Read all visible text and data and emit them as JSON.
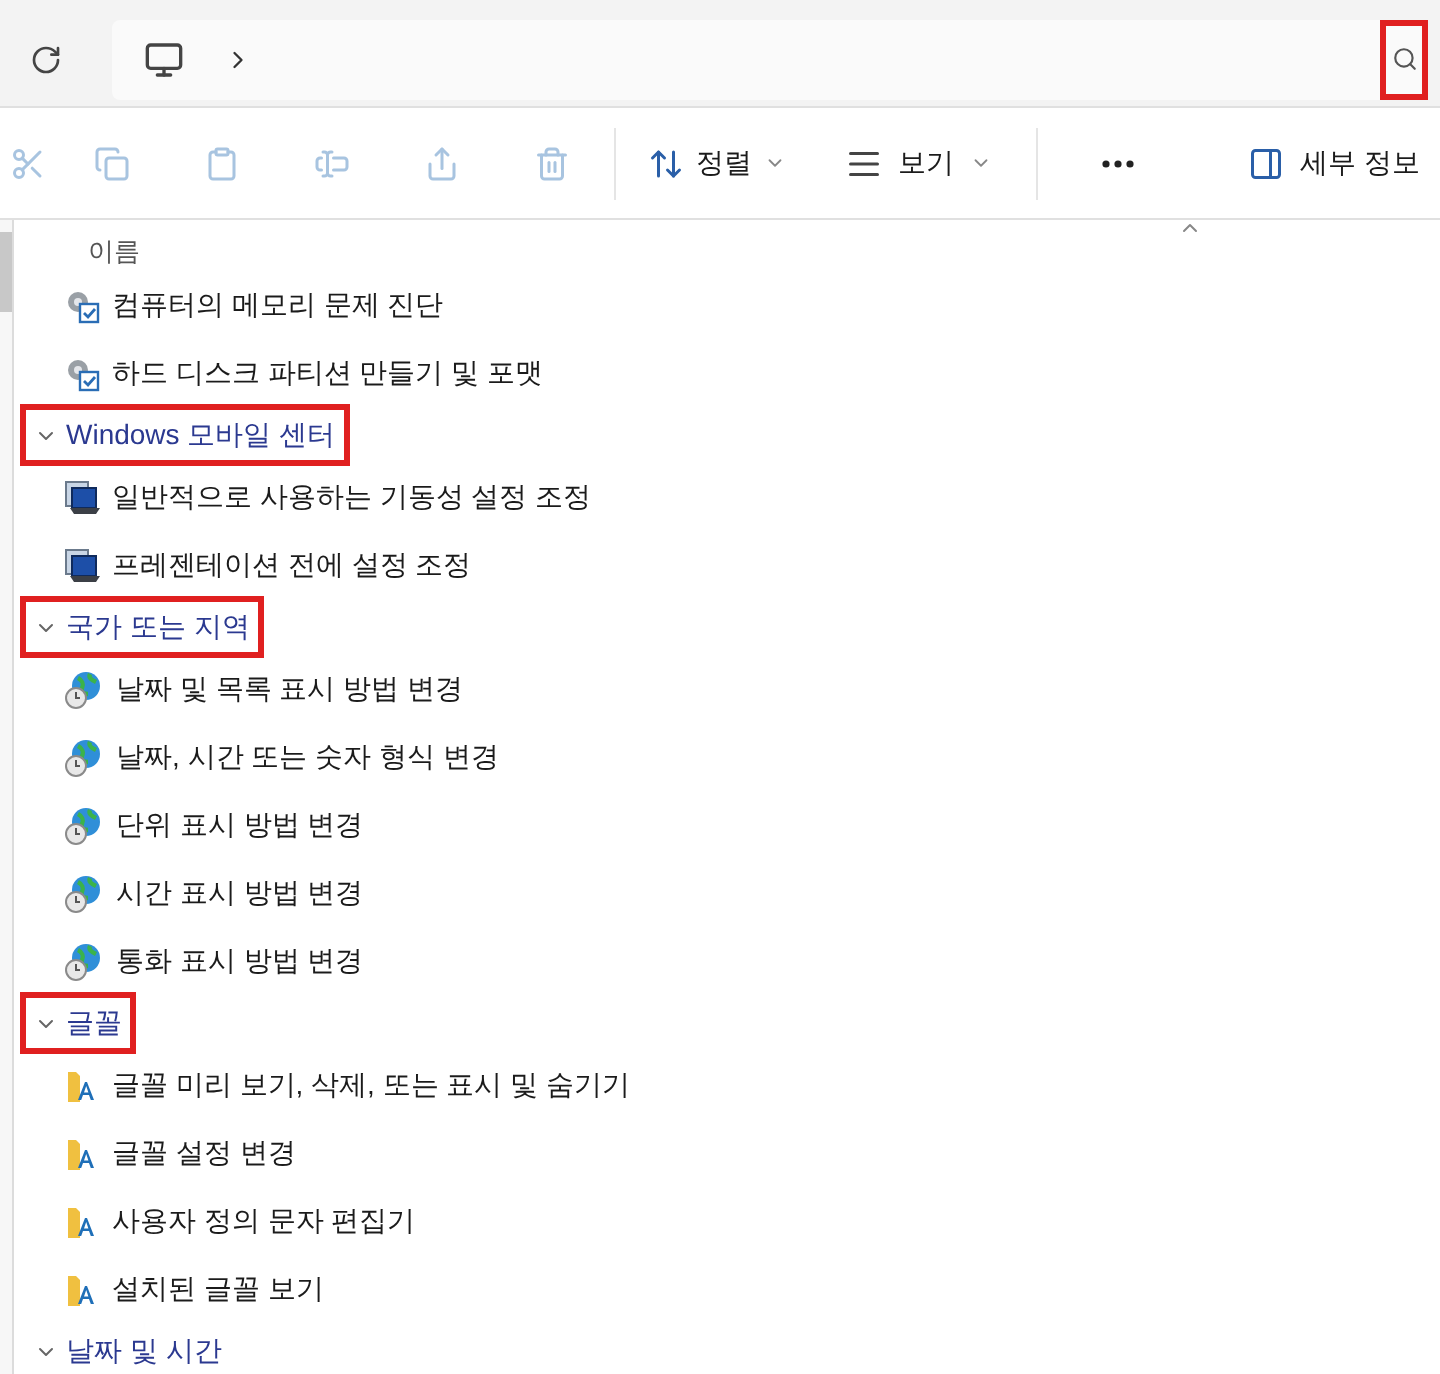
{
  "address_bar": {
    "search_highlighted": true
  },
  "toolbar": {
    "sort_label": "정렬",
    "view_label": "보기",
    "details_label": "세부 정보"
  },
  "column_header": "이름",
  "groups": [
    {
      "items": [
        {
          "kind": "tool",
          "label": "컴퓨터의 메모리 문제 진단"
        },
        {
          "kind": "tool",
          "label": "하드 디스크 파티션 만들기 및 포맷"
        }
      ]
    },
    {
      "title": "Windows 모바일 센터",
      "expanded": true,
      "highlighted": true,
      "items": [
        {
          "kind": "mobility",
          "label": "일반적으로 사용하는 기동성 설정 조정"
        },
        {
          "kind": "mobility",
          "label": "프레젠테이션 전에 설정 조정"
        }
      ]
    },
    {
      "title": "국가 또는 지역",
      "expanded": true,
      "highlighted": true,
      "items": [
        {
          "kind": "globe",
          "label": "날짜 및 목록 표시 방법 변경"
        },
        {
          "kind": "globe",
          "label": "날짜, 시간 또는 숫자 형식 변경"
        },
        {
          "kind": "globe",
          "label": "단위 표시 방법 변경"
        },
        {
          "kind": "globe",
          "label": "시간 표시 방법 변경"
        },
        {
          "kind": "globe",
          "label": "통화 표시 방법 변경"
        }
      ]
    },
    {
      "title": "글꼴",
      "expanded": true,
      "highlighted": true,
      "items": [
        {
          "kind": "font",
          "label": "글꼴 미리 보기, 삭제, 또는 표시 및 숨기기"
        },
        {
          "kind": "font",
          "label": "글꼴 설정 변경"
        },
        {
          "kind": "font",
          "label": "사용자 정의 문자 편집기"
        },
        {
          "kind": "font",
          "label": "설치된 글꼴 보기"
        }
      ]
    },
    {
      "title": "날짜 및 시간",
      "expanded": true,
      "highlighted": false
    }
  ]
}
